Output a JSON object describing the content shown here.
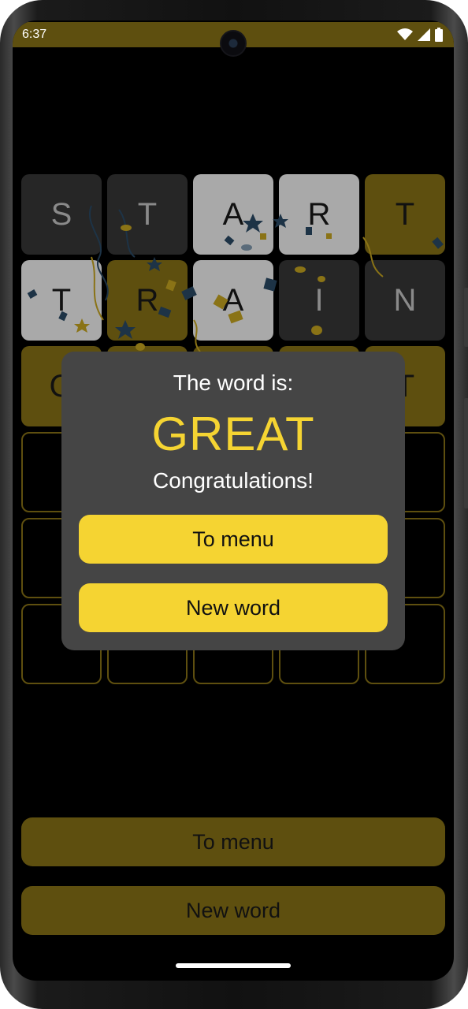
{
  "status_bar": {
    "time": "6:37",
    "icons": [
      "wifi-icon",
      "cellular-icon",
      "battery-icon"
    ]
  },
  "board": {
    "rows": [
      [
        {
          "letter": "S",
          "state": "dark"
        },
        {
          "letter": "T",
          "state": "dark"
        },
        {
          "letter": "A",
          "state": "gray"
        },
        {
          "letter": "R",
          "state": "gray"
        },
        {
          "letter": "T",
          "state": "gold"
        }
      ],
      [
        {
          "letter": "T",
          "state": "gray"
        },
        {
          "letter": "R",
          "state": "gold"
        },
        {
          "letter": "A",
          "state": "gray"
        },
        {
          "letter": "I",
          "state": "dark"
        },
        {
          "letter": "N",
          "state": "dark"
        }
      ],
      [
        {
          "letter": "G",
          "state": "gold"
        },
        {
          "letter": "",
          "state": "gold"
        },
        {
          "letter": "",
          "state": "gold"
        },
        {
          "letter": "",
          "state": "gold"
        },
        {
          "letter": "T",
          "state": "gold"
        }
      ],
      [
        {
          "letter": "",
          "state": "empty"
        },
        {
          "letter": "",
          "state": "empty"
        },
        {
          "letter": "",
          "state": "empty"
        },
        {
          "letter": "",
          "state": "empty"
        },
        {
          "letter": "",
          "state": "empty"
        }
      ],
      [
        {
          "letter": "",
          "state": "empty"
        },
        {
          "letter": "",
          "state": "empty"
        },
        {
          "letter": "",
          "state": "empty"
        },
        {
          "letter": "",
          "state": "empty"
        },
        {
          "letter": "",
          "state": "empty"
        }
      ],
      [
        {
          "letter": "",
          "state": "empty"
        },
        {
          "letter": "",
          "state": "empty"
        },
        {
          "letter": "",
          "state": "empty"
        },
        {
          "letter": "",
          "state": "empty"
        },
        {
          "letter": "",
          "state": "empty"
        }
      ]
    ]
  },
  "background_buttons": {
    "to_menu": "To menu",
    "new_word": "New word"
  },
  "dialog": {
    "title": "The word is:",
    "word": "GREAT",
    "subtitle": "Congratulations!",
    "to_menu": "To menu",
    "new_word": "New word"
  },
  "colors": {
    "accent": "#f5d432",
    "dimmed_accent": "#5e4f0f",
    "tile_dark": "#262626",
    "tile_gray": "#a9a9a9",
    "dialog_bg": "#454545"
  }
}
